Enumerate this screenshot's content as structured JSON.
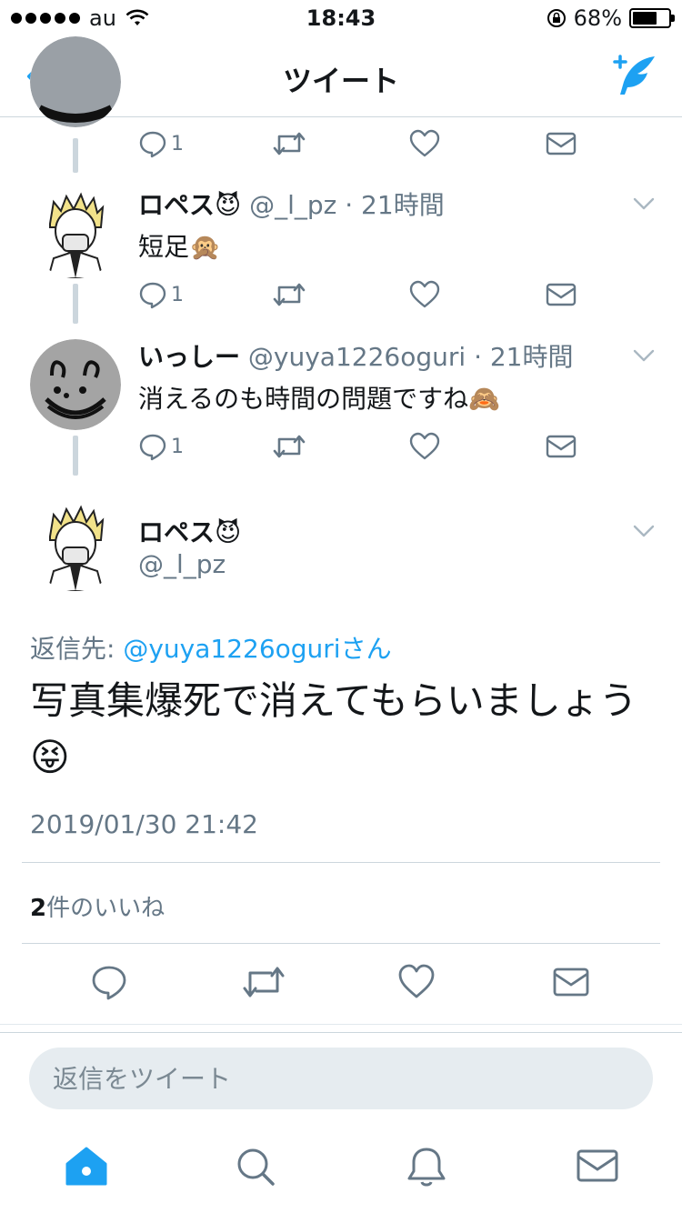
{
  "status": {
    "carrier": "au",
    "time": "18:43",
    "battery": "68%",
    "battery_level": 0.68
  },
  "nav": {
    "title": "ツイート",
    "back_icon": "chevron-left-icon",
    "compose_icon": "compose-tweet-icon"
  },
  "thread": [
    {
      "reply_count": "1"
    },
    {
      "name": "ロペス😈",
      "handle": "@_l_pz · 21時間",
      "text": "短足🙊",
      "reply_count": "1"
    },
    {
      "name": "いっしー",
      "handle": "@yuya1226oguri · 21時間",
      "text": "消えるのも時間の問題ですね🙈",
      "reply_count": "1"
    }
  ],
  "main_tweet": {
    "name": "ロペス😈",
    "handle": "@_l_pz",
    "reply_prefix": "返信先: ",
    "reply_target": "@yuya1226oguriさん",
    "text": "写真集爆死で消えてもらいましょう😝",
    "timestamp": "2019/01/30 21:42",
    "likes_count": "2",
    "likes_label": "件のいいね"
  },
  "reply_field": {
    "placeholder": "返信をツイート"
  },
  "tabs": [
    "home-icon",
    "search-icon",
    "notifications-icon",
    "messages-icon"
  ],
  "colors": {
    "accent": "#1da1f2",
    "secondary_text": "#657786",
    "divider": "#ccd6dd"
  }
}
